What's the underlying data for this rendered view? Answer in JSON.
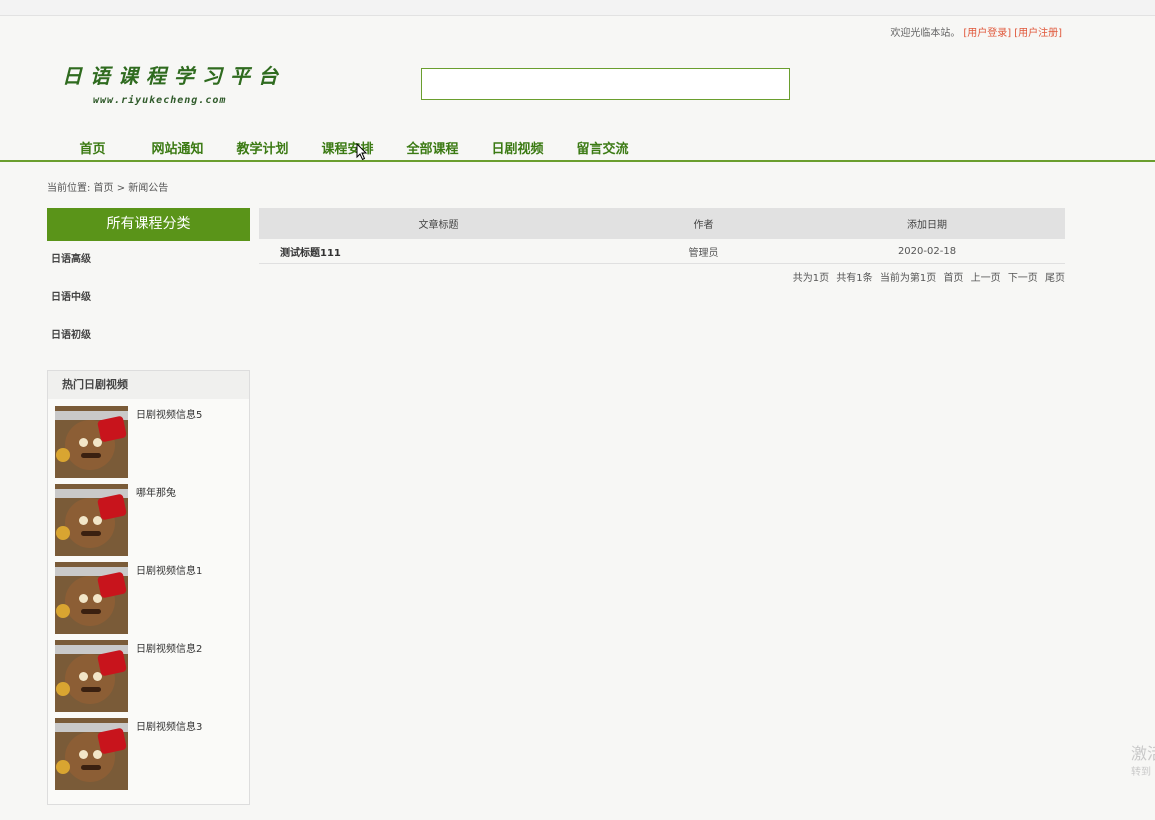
{
  "header": {
    "welcome_text": "欢迎光临本站。",
    "login_link": "[用户登录]",
    "register_link": "[用户注册]",
    "logo_title": "日语课程学习平台",
    "logo_url": "www.riyukecheng.com",
    "search_value": ""
  },
  "nav": {
    "items": [
      {
        "label": "首页"
      },
      {
        "label": "网站通知"
      },
      {
        "label": "教学计划"
      },
      {
        "label": "课程安排"
      },
      {
        "label": "全部课程"
      },
      {
        "label": "日剧视频"
      },
      {
        "label": "留言交流"
      }
    ]
  },
  "breadcrumb": "当前位置: 首页 > 新闻公告",
  "sidebar": {
    "categories_title": "所有课程分类",
    "categories": [
      {
        "label": "日语高级"
      },
      {
        "label": "日语中级"
      },
      {
        "label": "日语初级"
      }
    ],
    "hot_title": "热门日剧视频",
    "videos": [
      {
        "title": "日剧视频信息5"
      },
      {
        "title": "哪年那兔"
      },
      {
        "title": "日剧视频信息1"
      },
      {
        "title": "日剧视频信息2"
      },
      {
        "title": "日剧视频信息3"
      }
    ]
  },
  "table": {
    "headers": [
      "文章标题",
      "作者",
      "添加日期"
    ],
    "rows": [
      {
        "title": "测试标题111",
        "author": "管理员",
        "date": "2020-02-18"
      }
    ]
  },
  "pager": {
    "total_pages": "共为1页",
    "total_items": "共有1条",
    "current": "当前为第1页",
    "first": "首页",
    "prev": "上一页",
    "next": "下一页",
    "last": "尾页"
  },
  "watermark": {
    "line1": "激活",
    "line2": "转到"
  },
  "colors": {
    "accent_green": "#5a9419",
    "nav_green": "#3b7a13",
    "link_red": "#e0573a"
  }
}
